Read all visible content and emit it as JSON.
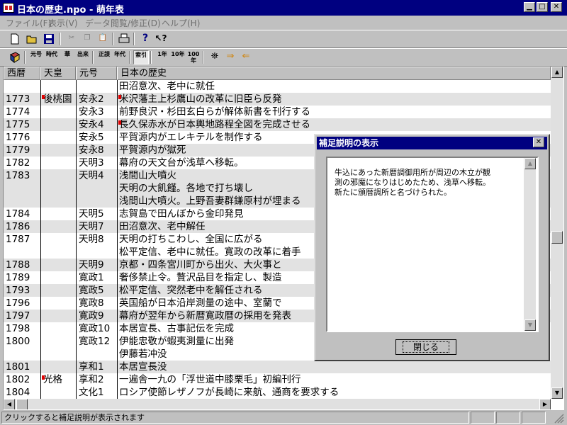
{
  "window": {
    "title": "日本の歴史.npo - 萌年表"
  },
  "menu": [
    "ファイル(F)",
    "表示(V)",
    "データ閲覧/修正(D)",
    "ヘルプ(H)"
  ],
  "toolbar2_labels": [
    "元号",
    "時代",
    "華",
    "出来",
    "正誤",
    "年代",
    "索引",
    "1年",
    "10年",
    "100年"
  ],
  "grid": {
    "headers": [
      "西暦",
      "天皇",
      "元号",
      "日本の歴史"
    ],
    "rows": [
      {
        "year": "",
        "emperor": "",
        "era": "",
        "history": "田沼意次、老中に就任",
        "alt": false
      },
      {
        "year": "1773",
        "emperor": "後桃園",
        "era": "安永2",
        "history": "米沢藩主上杉鷹山の改革に旧臣ら反発",
        "alt": true
      },
      {
        "year": "1774",
        "emperor": "",
        "era": "安永3",
        "history": "前野良沢・杉田玄白らが解体新書を刊行する",
        "alt": false
      },
      {
        "year": "1775",
        "emperor": "",
        "era": "安永4",
        "history": "長久保赤水が日本輿地路程全図を完成させる",
        "alt": true
      },
      {
        "year": "1776",
        "emperor": "",
        "era": "安永5",
        "history": "平賀源内がエレキテルを制作する",
        "alt": false
      },
      {
        "year": "1779",
        "emperor": "",
        "era": "安永8",
        "history": "平賀源内が獄死",
        "alt": true
      },
      {
        "year": "1782",
        "emperor": "",
        "era": "天明3",
        "history": "幕府の天文台が浅草へ移転。",
        "alt": false
      },
      {
        "year": "1783",
        "emperor": "",
        "era": "天明4",
        "history": "浅間山大噴火",
        "alt": true
      },
      {
        "year": "",
        "emperor": "",
        "era": "",
        "history": "天明の大飢饉。各地で打ち壊し",
        "alt": true
      },
      {
        "year": "",
        "emperor": "",
        "era": "",
        "history": "浅間山大噴火。上野吾妻群鎌原村が埋まる",
        "alt": true
      },
      {
        "year": "1784",
        "emperor": "",
        "era": "天明5",
        "history": "志賀島で田んぼから金印発見",
        "alt": false
      },
      {
        "year": "1786",
        "emperor": "",
        "era": "天明7",
        "history": "田沼意次、老中解任",
        "alt": true
      },
      {
        "year": "1787",
        "emperor": "",
        "era": "天明8",
        "history": "天明の打ちこわし、全国に広がる",
        "alt": false
      },
      {
        "year": "",
        "emperor": "",
        "era": "",
        "history": "松平定信、老中に就任。寛政の改革に着手",
        "alt": false
      },
      {
        "year": "1788",
        "emperor": "",
        "era": "天明9",
        "history": "京都・四条宮川町から出火、大火事と",
        "alt": true
      },
      {
        "year": "1789",
        "emperor": "",
        "era": "寛政1",
        "history": "奢侈禁止令。贅沢品目を指定し、製造",
        "alt": false
      },
      {
        "year": "1793",
        "emperor": "",
        "era": "寛政5",
        "history": "松平定信、突然老中を解任される",
        "alt": true
      },
      {
        "year": "1796",
        "emperor": "",
        "era": "寛政8",
        "history": "英国船が日本沿岸測量の途中、室蘭で",
        "alt": false
      },
      {
        "year": "1797",
        "emperor": "",
        "era": "寛政9",
        "history": "幕府が翌年から新暦寛政暦の採用を発表",
        "alt": true
      },
      {
        "year": "1798",
        "emperor": "",
        "era": "寛政10",
        "history": "本居宣長、古事記伝を完成",
        "alt": false
      },
      {
        "year": "1800",
        "emperor": "",
        "era": "寛政12",
        "history": "伊能忠敬が蝦夷測量に出発",
        "alt": false
      },
      {
        "year": "",
        "emperor": "",
        "era": "",
        "history": "伊藤若冲没",
        "alt": false
      },
      {
        "year": "1801",
        "emperor": "",
        "era": "享和1",
        "history": "本居宣長没",
        "alt": true
      },
      {
        "year": "1802",
        "emperor": "光格",
        "era": "享和2",
        "history": "一遍舎一九の「浮世道中膝栗毛」初編刊行",
        "alt": false
      },
      {
        "year": "1804",
        "emperor": "",
        "era": "文化1",
        "history": "ロシア使節レザノフが長崎に来航、通商を要求する",
        "alt": false
      }
    ]
  },
  "dialog": {
    "title": "補足説明の表示",
    "text": "牛込にあった新暦調御用所が周辺の木立が観\n測の邪魔になりはじめたため、浅草へ移転。\n新たに頒暦調所と名づけられた。",
    "ok_label": "閉じる"
  },
  "status": {
    "text": "クリックすると補足説明が表示されます"
  }
}
